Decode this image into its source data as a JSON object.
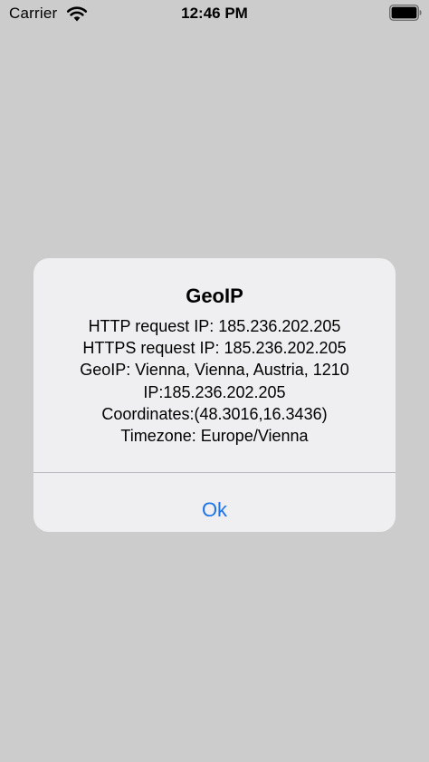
{
  "status_bar": {
    "carrier": "Carrier",
    "time": "12:46 PM",
    "wifi_icon": "wifi-icon",
    "battery_icon": "battery-icon",
    "battery_level": 1.0
  },
  "alert": {
    "title": "GeoIP",
    "lines": [
      "HTTP request IP: 185.236.202.205",
      "HTTPS request IP: 185.236.202.205",
      "GeoIP: Vienna, Vienna, Austria, 1210",
      "IP:185.236.202.205",
      "Coordinates:(48.3016,16.3436)",
      "Timezone: Europe/Vienna"
    ],
    "ok_label": "Ok",
    "button_color": "#1a73e8"
  }
}
